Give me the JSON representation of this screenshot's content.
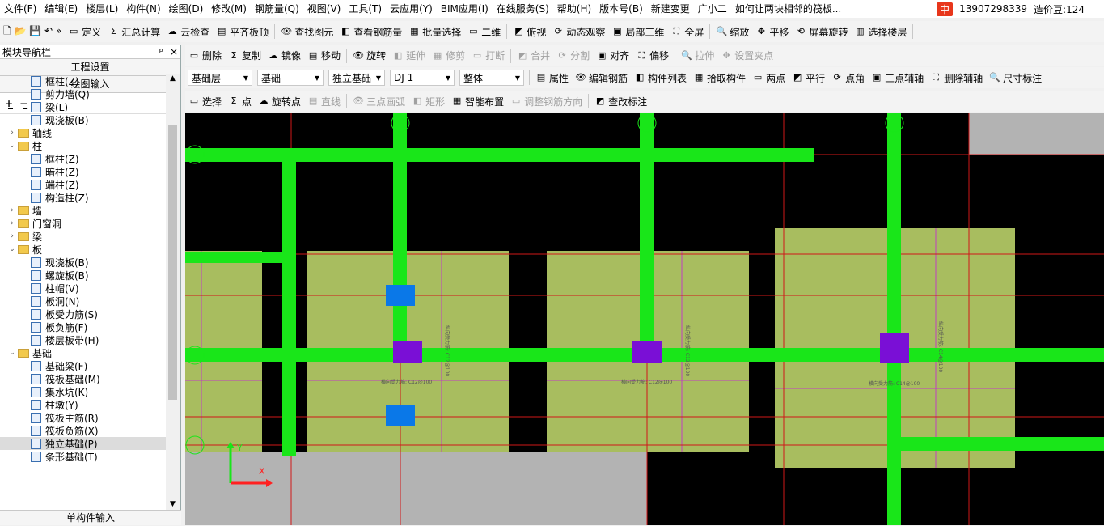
{
  "menu": {
    "items": [
      "文件(F)",
      "编辑(E)",
      "楼层(L)",
      "构件(N)",
      "绘图(D)",
      "修改(M)",
      "钢筋量(Q)",
      "视图(V)",
      "工具(T)",
      "云应用(Y)",
      "BIM应用(I)",
      "在线服务(S)",
      "帮助(H)",
      "版本号(B)",
      "新建变更",
      "广小二",
      "如何让两块相邻的筏板..."
    ],
    "ime": "中",
    "phone": "13907298339",
    "beans": "造价豆:124"
  },
  "toolbar1": [
    "定义",
    "汇总计算",
    "云检查",
    "平齐板顶",
    "查找图元",
    "查看钢筋量",
    "批量选择",
    "二维",
    "俯视",
    "动态观察",
    "局部三维",
    "全屏",
    "缩放",
    "平移",
    "屏幕旋转",
    "选择楼层"
  ],
  "toolbar2": [
    "删除",
    "复制",
    "镜像",
    "移动",
    "旋转",
    "延伸",
    "修剪",
    "打断",
    "合并",
    "分割",
    "对齐",
    "偏移",
    "拉伸",
    "设置夹点"
  ],
  "toolbar3": {
    "combos": [
      "基础层",
      "基础",
      "独立基础",
      "DJ-1",
      "整体"
    ],
    "buttons": [
      "属性",
      "编辑钢筋",
      "构件列表",
      "拾取构件",
      "两点",
      "平行",
      "点角",
      "三点辅轴",
      "删除辅轴",
      "尺寸标注"
    ]
  },
  "toolbar4": [
    "选择",
    "点",
    "旋转点",
    "直线",
    "三点画弧",
    "矩形",
    "智能布置",
    "调整钢筋方向",
    "查改标注"
  ],
  "panel": {
    "title": "模块导航栏",
    "pin": "ᵖ",
    "close": "×",
    "project_settings": "工程设置",
    "draw_input": "绘图输入",
    "single_input": "单构件输入"
  },
  "tree": [
    {
      "l": 2,
      "t": "框柱(Z)",
      "leaf": true
    },
    {
      "l": 2,
      "t": "剪力墙(Q)",
      "leaf": true
    },
    {
      "l": 2,
      "t": "梁(L)",
      "leaf": true
    },
    {
      "l": 2,
      "t": "现浇板(B)",
      "leaf": true
    },
    {
      "l": 1,
      "t": "轴线",
      "exp": "›"
    },
    {
      "l": 1,
      "t": "柱",
      "exp": "⌄"
    },
    {
      "l": 2,
      "t": "框柱(Z)",
      "leaf": true
    },
    {
      "l": 2,
      "t": "暗柱(Z)",
      "leaf": true
    },
    {
      "l": 2,
      "t": "端柱(Z)",
      "leaf": true
    },
    {
      "l": 2,
      "t": "构造柱(Z)",
      "leaf": true
    },
    {
      "l": 1,
      "t": "墙",
      "exp": "›"
    },
    {
      "l": 1,
      "t": "门窗洞",
      "exp": "›"
    },
    {
      "l": 1,
      "t": "梁",
      "exp": "›"
    },
    {
      "l": 1,
      "t": "板",
      "exp": "⌄"
    },
    {
      "l": 2,
      "t": "现浇板(B)",
      "leaf": true
    },
    {
      "l": 2,
      "t": "螺旋板(B)",
      "leaf": true
    },
    {
      "l": 2,
      "t": "柱帽(V)",
      "leaf": true
    },
    {
      "l": 2,
      "t": "板洞(N)",
      "leaf": true
    },
    {
      "l": 2,
      "t": "板受力筋(S)",
      "leaf": true
    },
    {
      "l": 2,
      "t": "板负筋(F)",
      "leaf": true
    },
    {
      "l": 2,
      "t": "楼层板带(H)",
      "leaf": true
    },
    {
      "l": 1,
      "t": "基础",
      "exp": "⌄"
    },
    {
      "l": 2,
      "t": "基础梁(F)",
      "leaf": true
    },
    {
      "l": 2,
      "t": "筏板基础(M)",
      "leaf": true
    },
    {
      "l": 2,
      "t": "集水坑(K)",
      "leaf": true
    },
    {
      "l": 2,
      "t": "柱墩(Y)",
      "leaf": true
    },
    {
      "l": 2,
      "t": "筏板主筋(R)",
      "leaf": true
    },
    {
      "l": 2,
      "t": "筏板负筋(X)",
      "leaf": true
    },
    {
      "l": 2,
      "t": "独立基础(P)",
      "leaf": true,
      "sel": true
    },
    {
      "l": 2,
      "t": "条形基础(T)",
      "leaf": true
    }
  ],
  "canvas": {
    "rebar_labels": [
      "横向受力筋: C12@100",
      "横向受力筋: C12@100",
      "横向受力筋: C14@100"
    ],
    "vert_labels": [
      "纵向受力筋: C12@100",
      "纵向受力筋: C12@100",
      "纵向受力筋: C14@100"
    ],
    "ucs_y": "Y",
    "ucs_x": "X",
    "colors": {
      "beam": "#19e619",
      "pad": "#a8bd5f",
      "col": "#7a0fd6",
      "blue": "#0a78e8"
    }
  }
}
